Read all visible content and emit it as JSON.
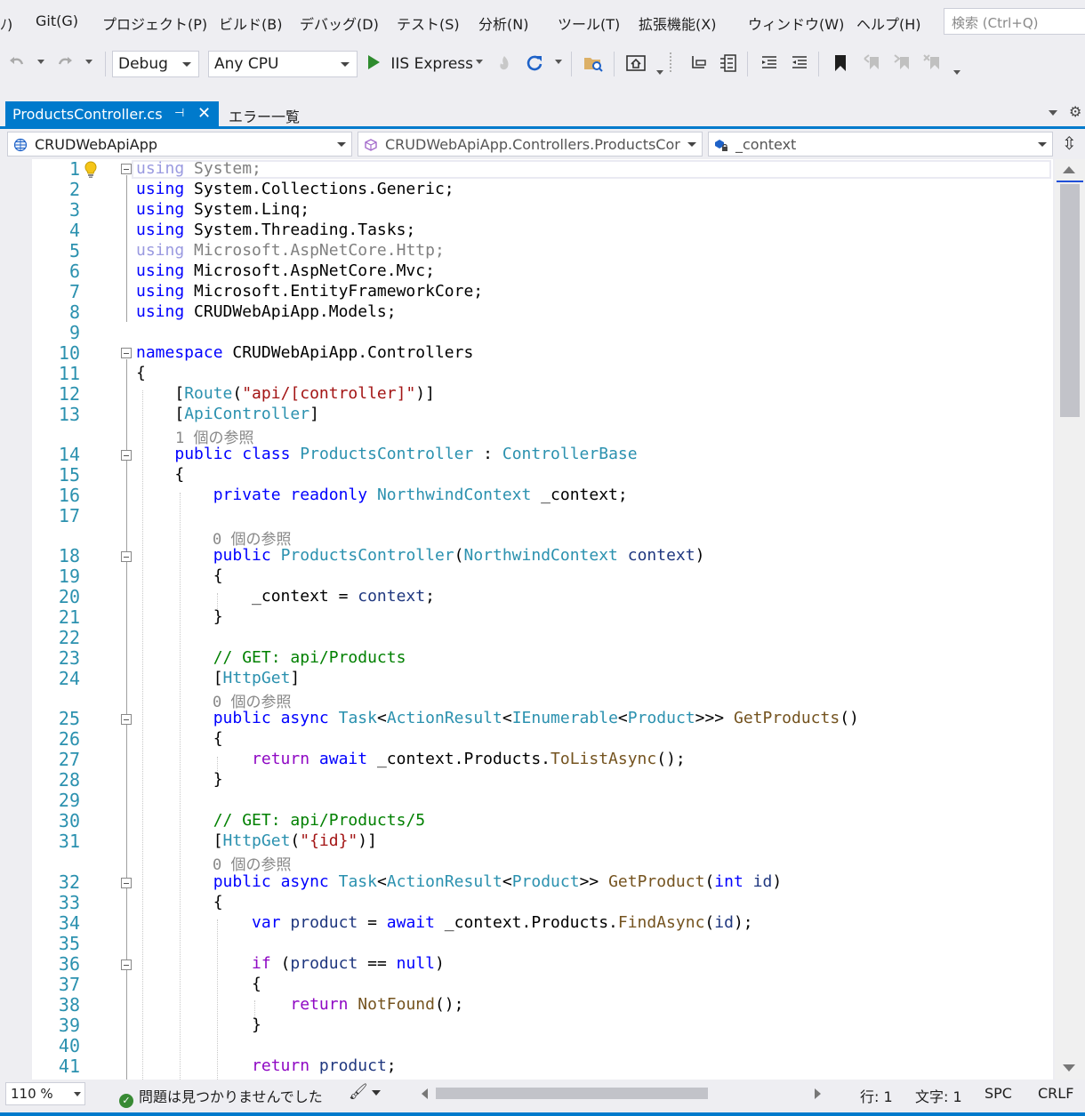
{
  "menu": {
    "items": [
      "ﾉ)",
      "Git(G)",
      "プロジェクト(P)",
      "ビルド(B)",
      "デバッグ(D)",
      "テスト(S)",
      "分析(N)",
      "ツール(T)",
      "拡張機能(X)",
      "ウィンドウ(W)",
      "ヘルプ(H)"
    ],
    "search_placeholder": "検索 (Ctrl+Q)"
  },
  "toolbar": {
    "configuration": "Debug",
    "platform": "Any CPU",
    "run_target": "IIS Express",
    "run_color": "#2e8b2e"
  },
  "tabs": {
    "active": "ProductsController.cs",
    "second": "エラー一覧"
  },
  "navbar": {
    "project": "CRUDWebApiApp",
    "type": "CRUDWebApiApp.Controllers.ProductsCor",
    "member": "_context"
  },
  "editor": {
    "line_numbers": [
      "1",
      "2",
      "3",
      "4",
      "5",
      "6",
      "7",
      "8",
      "9",
      "10",
      "11",
      "12",
      "13",
      "14",
      "15",
      "16",
      "17",
      "18",
      "19",
      "20",
      "21",
      "22",
      "23",
      "24",
      "25",
      "26",
      "27",
      "28",
      "29",
      "30",
      "31",
      "32",
      "33",
      "34",
      "35",
      "36",
      "37",
      "38",
      "39",
      "40",
      "41"
    ],
    "lens": {
      "class_refs": "1 個の参照",
      "ctor_refs": "0 個の参照",
      "getproducts_refs": "0 個の参照",
      "getproduct_refs": "0 個の参照"
    },
    "colors": {
      "keyword": "#0000ff",
      "type": "#2b91af",
      "string": "#a31515",
      "comment": "#008000",
      "method": "#74531f",
      "line_number": "#2b91af",
      "accent": "#007acc"
    }
  },
  "status": {
    "zoom": "110 %",
    "issues": "問題は見つかりませんでした",
    "line": "行: 1",
    "char": "文字: 1",
    "spc": "SPC",
    "eol": "CRLF"
  }
}
